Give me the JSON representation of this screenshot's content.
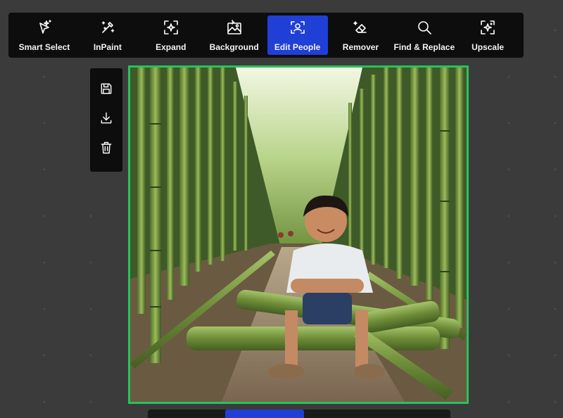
{
  "toolbar": {
    "items": [
      {
        "label": "Smart Select",
        "icon": "smart-select-icon"
      },
      {
        "label": "InPaint",
        "icon": "inpaint-icon"
      },
      {
        "label": "Expand",
        "icon": "expand-icon"
      },
      {
        "label": "Background",
        "icon": "background-icon"
      },
      {
        "label": "Edit People",
        "icon": "edit-people-icon",
        "active": true
      },
      {
        "label": "Remover",
        "icon": "eraser-icon"
      },
      {
        "label": "Find & Replace",
        "icon": "search-icon"
      },
      {
        "label": "Upscale",
        "icon": "upscale-icon"
      }
    ],
    "active_color": "#1f3fd6"
  },
  "side_actions": [
    "save-icon",
    "download-icon",
    "trash-icon"
  ],
  "canvas": {
    "image": "boy-sitting-on-bamboo-in-bamboo-forest",
    "border_color": "#27c35a"
  }
}
